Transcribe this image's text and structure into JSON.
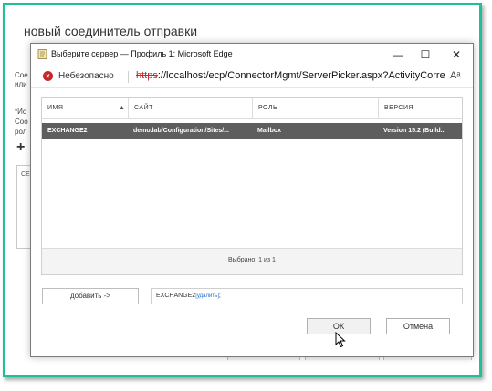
{
  "background": {
    "title": "новый соединитель отправки",
    "lines": [
      "Сое",
      "или",
      "*Ис",
      "Соо",
      "рол"
    ],
    "list_header": "СЕ"
  },
  "window": {
    "title": "Выберите сервер — Профиль 1: Microsoft Edge",
    "minimize_glyph": "—",
    "maximize_glyph": "☐",
    "close_glyph": "✕"
  },
  "address_bar": {
    "insecure_label": "Небезопасно",
    "url_scheme": "https",
    "url_rest": "://localhost/ecp/ConnectorMgmt/ServerPicker.aspx?ActivityCorrel...",
    "read_aloud_glyph": "Aᵃ"
  },
  "grid": {
    "columns": [
      "ИМЯ",
      "САЙТ",
      "РОЛЬ",
      "ВЕРСИЯ"
    ],
    "sort_glyph": "▲",
    "rows": [
      [
        "EXCHANGE2",
        "demo.lab/Configuration/Sites/...",
        "Mailbox",
        "Version 15.2 (Build..."
      ]
    ],
    "footer": "Выбрано: 1 из 1"
  },
  "add_button_label": "добавить ->",
  "selection": {
    "value": "EXCHANGE2",
    "remove_label": "[удалить]",
    "suffix": ";"
  },
  "ok_label": "ОК",
  "cancel_label": "Отмена",
  "colors": {
    "frame_accent": "#1fbf97",
    "selected_row": "#5e5e5e",
    "insecure": "#c62828",
    "link": "#2a6fc9"
  }
}
